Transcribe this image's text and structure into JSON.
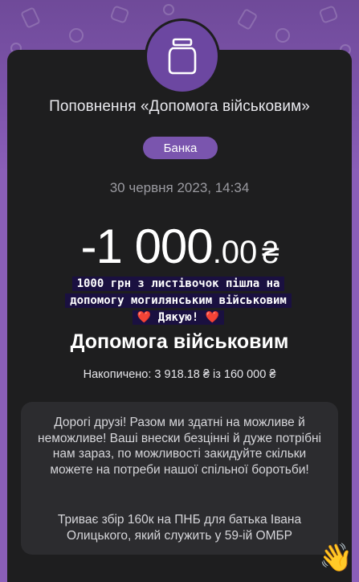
{
  "header": {
    "icon": "jar-icon",
    "title": "Поповнення «Допомога військовим»",
    "badge_label": "Банка"
  },
  "transaction": {
    "datetime": "30 червня 2023, 14:34",
    "amount_integer": "-1 000",
    "amount_decimal": ".00",
    "currency": "₴"
  },
  "overlay_caption": {
    "line1": "1000 грн з листівочок пішла на",
    "line2": "допомогу могилянським військовим",
    "line3": "Дякую!",
    "heart": "❤️"
  },
  "jar": {
    "name": "Допомога військовим",
    "progress_text": "Накопичено: 3 918.18 ₴ із 160 000 ₴",
    "accumulated": 3918.18,
    "goal": 160000
  },
  "description": {
    "paragraph1": "Дорогі друзі! Разом ми здатні на можливе й неможливе! Ваші внески безцінні й дуже потрібні нам зараз, по можливості закидуйте скільки можете на потреби нашої спільної боротьби!",
    "paragraph2": "Триває збір 160к на ПНБ для батька Івана Олицького, який служить у 59-ій ОМБР"
  },
  "decor": {
    "wave_emoji": "👋"
  },
  "colors": {
    "accent_purple": "#7a55ae",
    "background": "#1c1c1e",
    "heart": "#ff2d55"
  }
}
